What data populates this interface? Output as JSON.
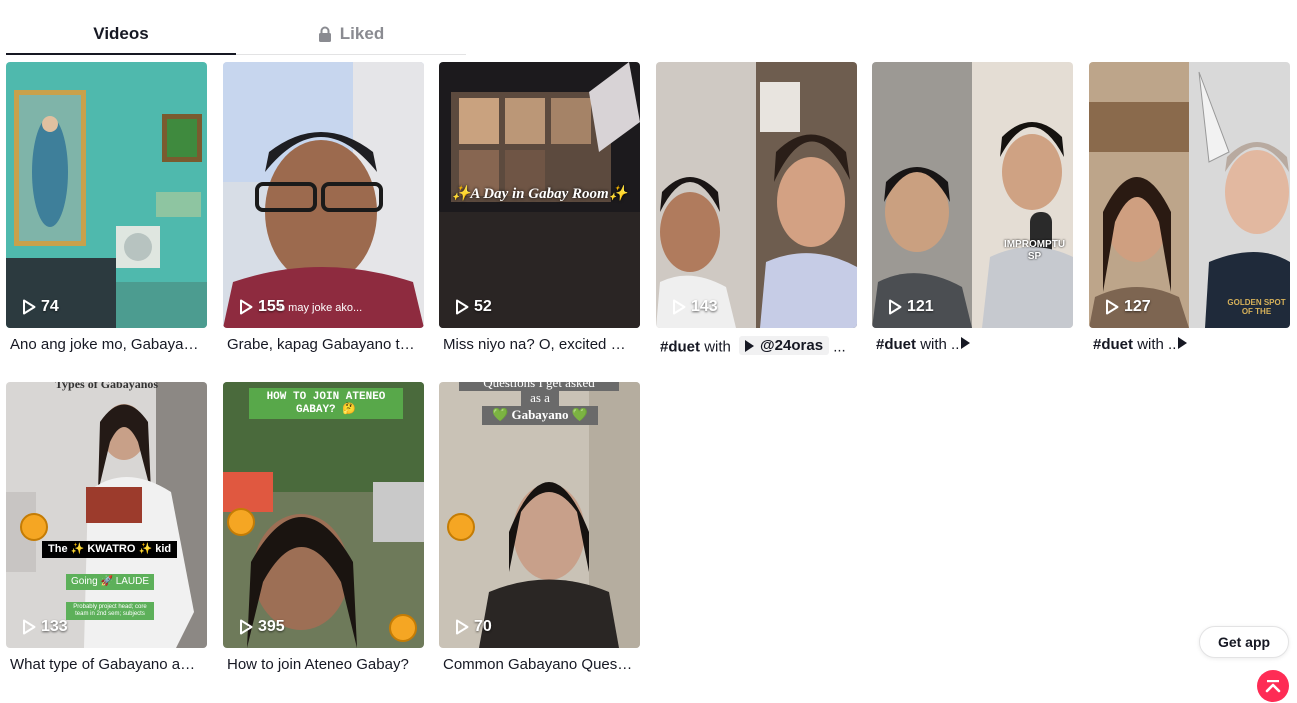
{
  "tabs": {
    "videos": "Videos",
    "liked": "Liked"
  },
  "videos": [
    {
      "views": "74",
      "caption": "Ano ang joke mo, Gabayano?"
    },
    {
      "views": "155",
      "caption": "Grabe, kapag Gabayano talaga",
      "overlay": "o may joke ako..."
    },
    {
      "views": "52",
      "caption": "Miss niyo na? O, excited na kayo?",
      "overlay": "✨A Day in Gabay Room✨"
    },
    {
      "views": "143",
      "caption_tag": "#duet",
      "caption_with": "with",
      "mention": "@24oras",
      "caption_tail": "..."
    },
    {
      "views": "121",
      "caption_tag": "#duet",
      "caption_with": "with ..",
      "overlay": "IMPROMPTU SP"
    },
    {
      "views": "127",
      "caption_tag": "#duet",
      "caption_with": "with ..",
      "overlay": "GOLDEN SPOT OF THE"
    },
    {
      "views": "133",
      "caption": "What type of Gabayano are you?",
      "overlay_title": "Types of Gabayanos",
      "overlay_label": "The ✨ KWATRO ✨ kid",
      "overlay_sub": "Going 🚀 LAUDE",
      "overlay_small": "Probably project head; core team in 2nd sem; subjects"
    },
    {
      "views": "395",
      "caption": "How to join Ateneo Gabay?",
      "overlay": "HOW TO JOIN ATENEO GABAY? 🤔"
    },
    {
      "views": "70",
      "caption": "Common Gabayano Questions",
      "overlay_line1": "Questions I get asked",
      "overlay_line2": "as a",
      "overlay_line3": "💚 Gabayano 💚"
    }
  ],
  "get_app": "Get app",
  "icons": {
    "play": "play-icon",
    "lock": "lock-icon",
    "back_to_top": "arrow-up-icon"
  },
  "colors": {
    "accent": "#fe2c55",
    "text": "#161823",
    "muted": "#8a8b91"
  }
}
